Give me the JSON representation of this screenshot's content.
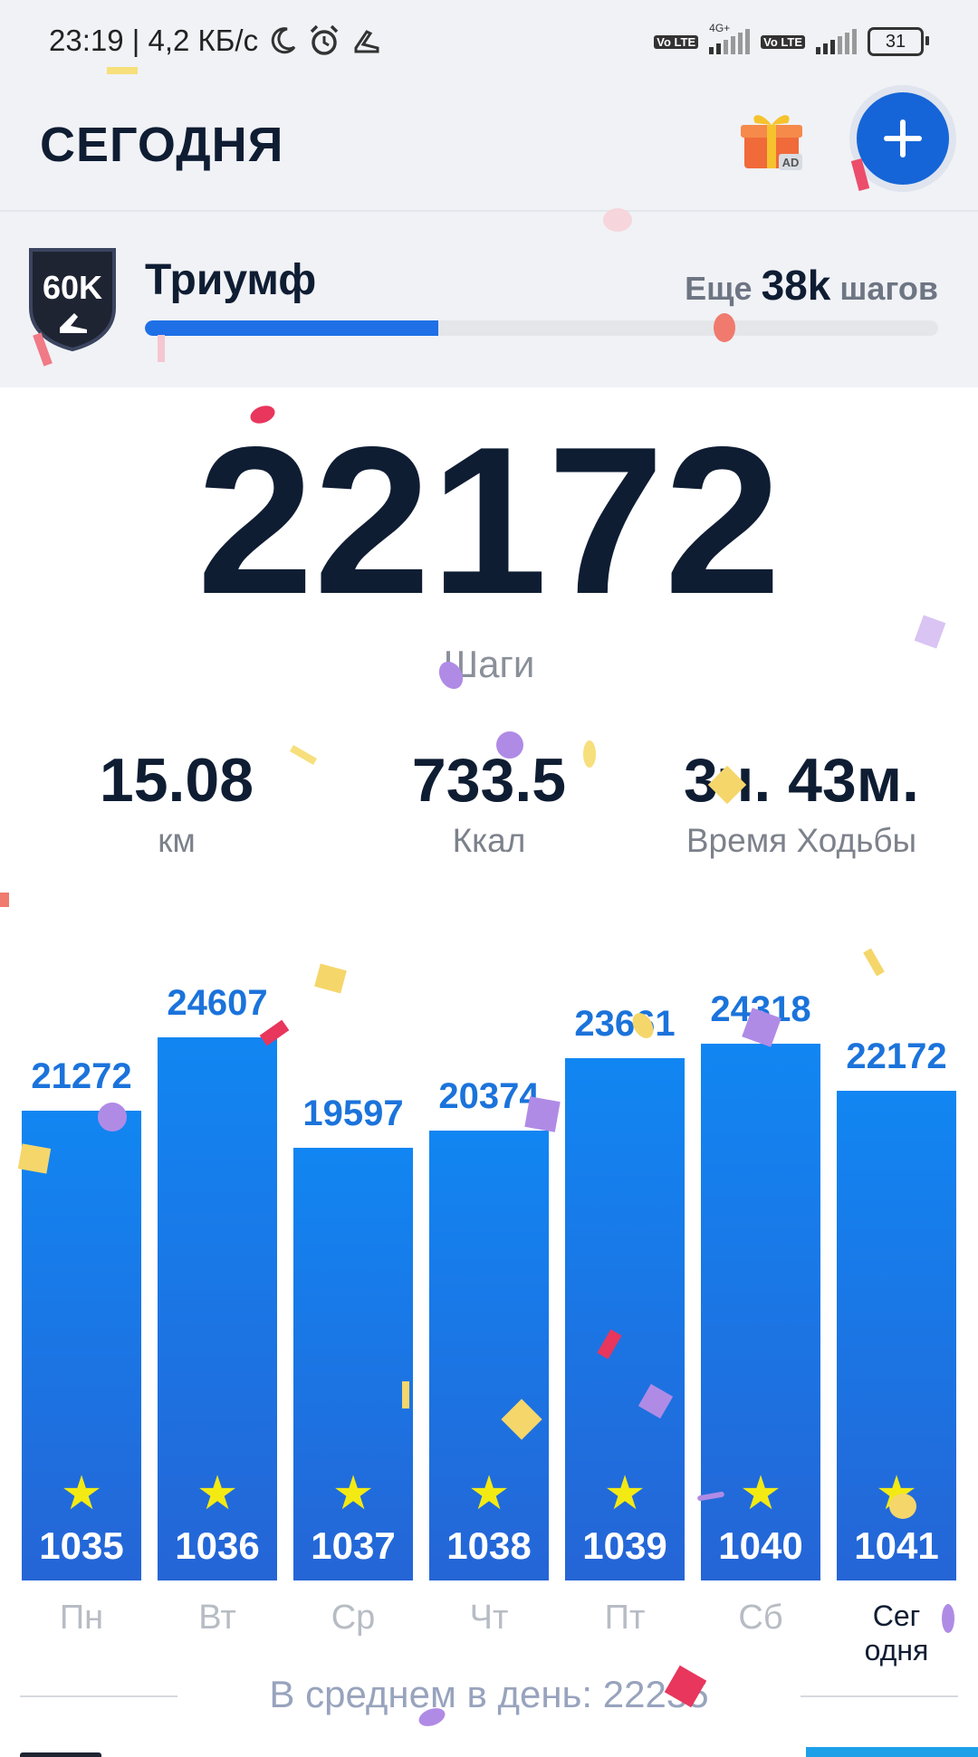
{
  "status_bar": {
    "time_speed": "23:19 | 4,2 КБ/с",
    "network_label": "4G+",
    "volte_label": "Vo LTE",
    "battery": "31"
  },
  "header": {
    "title": "СЕГОДНЯ",
    "gift_ad_label": "AD"
  },
  "achievement": {
    "badge_text": "60K",
    "title": "Триумф",
    "remaining_prefix": "Еще",
    "remaining_value": "38k",
    "remaining_suffix": "шагов",
    "progress_fraction": 0.37
  },
  "steps": {
    "value": "22172",
    "label": "Шаги"
  },
  "stats": [
    {
      "value": "15.08",
      "label": "км"
    },
    {
      "value": "733.5",
      "label": "Ккал"
    },
    {
      "value": "3ч. 43м.",
      "label": "Время Ходьбы"
    }
  ],
  "chart_data": {
    "type": "bar",
    "categories": [
      "Пн",
      "Вт",
      "Ср",
      "Чт",
      "Пт",
      "Сб",
      "Сег\nодня"
    ],
    "values": [
      21272,
      24607,
      19597,
      20374,
      23661,
      24318,
      22172
    ],
    "bar_counts": [
      "1035",
      "1036",
      "1037",
      "1038",
      "1039",
      "1040",
      "1041"
    ],
    "star_icon": "★",
    "ylim": [
      0,
      24607
    ],
    "today_index": 6,
    "colors": {
      "bar_top": "#1186f2",
      "bar_bottom": "#2565d6",
      "value_label": "#1b73db",
      "star": "#f3ea14"
    }
  },
  "average": {
    "text": "В среднем в день: 22235"
  },
  "colors": {
    "accent": "#1565d8",
    "dark_text": "#0f1d33",
    "background_top": "#f0f2f6"
  }
}
